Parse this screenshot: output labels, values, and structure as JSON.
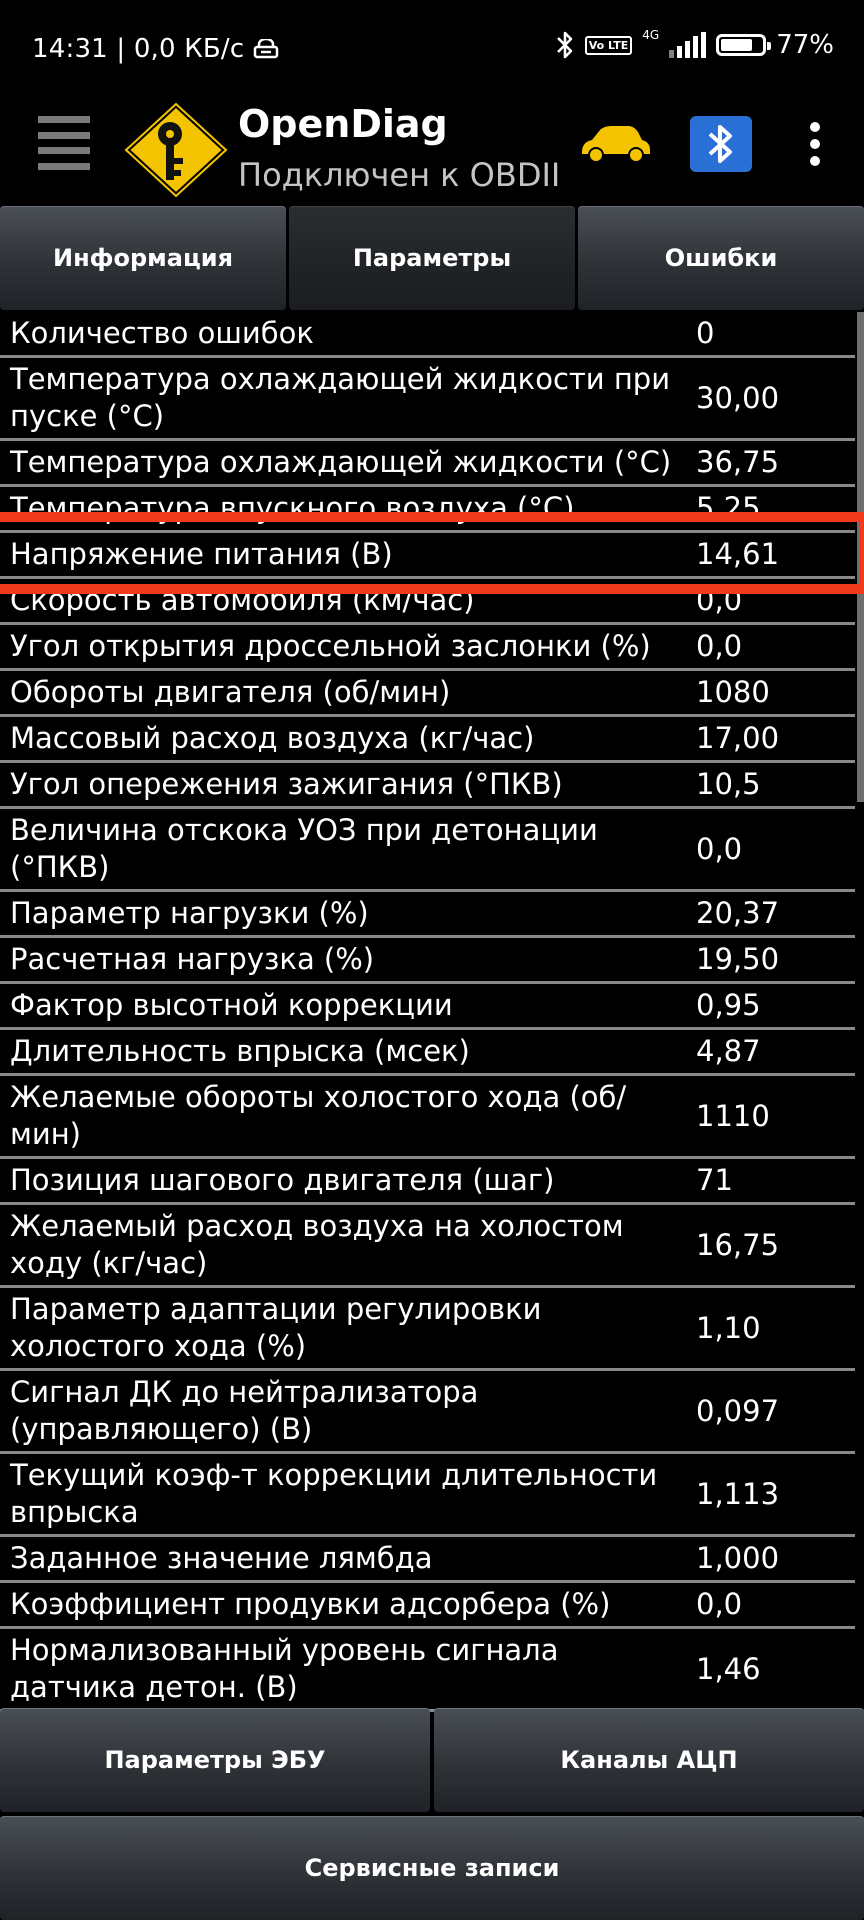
{
  "status": {
    "time_net": "14:31 | 0,0 КБ/с",
    "volte": "Vo LTE",
    "network": "4G",
    "battery_percent": "77%",
    "battery_level": 0.77
  },
  "app": {
    "title": "OpenDiag",
    "subtitle": "Подключен к OBDII"
  },
  "tabs": [
    {
      "label": "Информация"
    },
    {
      "label": "Параметры"
    },
    {
      "label": "Ошибки"
    }
  ],
  "params": [
    {
      "label": "Количество ошибок",
      "value": "0"
    },
    {
      "label": "Температура охлаждающей жидкости при пуске (°C)",
      "value": "30,00"
    },
    {
      "label": "Температура охлаждающей жидкости (°C)",
      "value": "36,75"
    },
    {
      "label": "Температура впускного воздуха (°C)",
      "value": "5,25"
    },
    {
      "label": "Напряжение питания (В)",
      "value": "14,61"
    },
    {
      "label": "Скорость автомобиля (км/час)",
      "value": "0,0"
    },
    {
      "label": "Угол открытия дроссельной заслонки (%)",
      "value": "0,0"
    },
    {
      "label": "Обороты двигателя (об/мин)",
      "value": "1080"
    },
    {
      "label": "Массовый расход воздуха (кг/час)",
      "value": "17,00"
    },
    {
      "label": "Угол опережения зажигания (°ПКВ)",
      "value": "10,5"
    },
    {
      "label": "Величина отскока УОЗ при детонации (°ПКВ)",
      "value": "0,0"
    },
    {
      "label": "Параметр нагрузки (%)",
      "value": "20,37"
    },
    {
      "label": "Расчетная нагрузка (%)",
      "value": "19,50"
    },
    {
      "label": "Фактор высотной коррекции",
      "value": "0,95"
    },
    {
      "label": "Длительность впрыска (мсек)",
      "value": "4,87"
    },
    {
      "label": "Желаемые обороты холостого хода (об/мин)",
      "value": "1110"
    },
    {
      "label": "Позиция шагового двигателя (шаг)",
      "value": "71"
    },
    {
      "label": "Желаемый расход воздуха на холостом ходу (кг/час)",
      "value": "16,75"
    },
    {
      "label": "Параметр адаптации регулировки холостого хода (%)",
      "value": "1,10"
    },
    {
      "label": "Сигнал ДК до нейтрализатора (управляющего) (В)",
      "value": "0,097"
    },
    {
      "label": "Текущий коэф-т коррекции длительности впрыска",
      "value": "1,113"
    },
    {
      "label": "Заданное значение лямбда",
      "value": "1,000"
    },
    {
      "label": "Коэффициент продувки адсорбера (%)",
      "value": "0,0"
    },
    {
      "label": "Нормализованный уровень сигнала датчика детон. (В)",
      "value": "1,46"
    }
  ],
  "buttons": {
    "ecu_params": "Параметры ЭБУ",
    "adc_channels": "Каналы АЦП",
    "service_records": "Сервисные записи"
  },
  "colors": {
    "highlight": "#f23a1d",
    "logo_yellow": "#f5c400",
    "bluetooth_blue": "#2a6fd6"
  }
}
